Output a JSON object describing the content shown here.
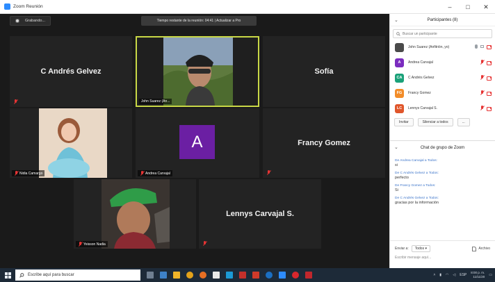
{
  "window": {
    "title": "Zoom Reunión",
    "minimize": "–",
    "maximize": "□",
    "close": "✕"
  },
  "recording": {
    "label": "Grabando..."
  },
  "banner": {
    "text": "Tiempo restante de la reunión: 04:41 | Actualizar a Pro"
  },
  "tiles": [
    {
      "name": "C Andrés Gelvez"
    },
    {
      "name": "John Suarez (An...",
      "label": "John Suarez (An..."
    },
    {
      "name": "Sofía"
    },
    {
      "name": "Nidia Camargo",
      "label": "Nidia Camargo"
    },
    {
      "name": "Andrea Carvajal",
      "label": "Andrea Carvajal",
      "initial": "A"
    },
    {
      "name": "Francy Gomez"
    },
    {
      "name": "Yeisson Nadia",
      "label": "Yeisson Nadia"
    },
    {
      "name": "Lennys Carvajal S."
    }
  ],
  "participants": {
    "title": "Participantes (8)",
    "search_placeholder": "Buscar un participante",
    "list": [
      {
        "initials": "",
        "name": "John Suarez (Anfitrión, yo)",
        "color": "#4a4a4a"
      },
      {
        "initials": "A",
        "name": "Andrea Carvajal",
        "color": "#7b2cbf"
      },
      {
        "initials": "CA",
        "name": "C Andrés Gelvez",
        "color": "#1aa179"
      },
      {
        "initials": "FG",
        "name": "Francy Gomez",
        "color": "#f28c28"
      },
      {
        "initials": "LC",
        "name": "Lennys Carvajal S.",
        "color": "#e0562b"
      }
    ],
    "invite_label": "Invitar",
    "mute_all_label": "Silenciar a todos",
    "more_label": "..."
  },
  "chat": {
    "title": "Chat de grupo de Zoom",
    "messages": [
      {
        "from": "De Andrea Carvajal a Todos:",
        "text": "si"
      },
      {
        "from": "De C Andrés Gelvez a Todos:",
        "text": "perfecto"
      },
      {
        "from": "De Francy Gomez a Todos:",
        "text": "Si"
      },
      {
        "from": "De C Andrés Gelvez a Todos:",
        "text": "gracias por la información"
      }
    ],
    "send_to_label": "Enviar a:",
    "send_to_value": "Todos ▾",
    "file_label": "Archivo",
    "input_placeholder": "Escribir mensaje aquí..."
  },
  "taskbar": {
    "search_placeholder": "Escribe aquí para buscar",
    "language": "ESP",
    "time": "8:00 p. m.",
    "date": "11/11/20"
  }
}
